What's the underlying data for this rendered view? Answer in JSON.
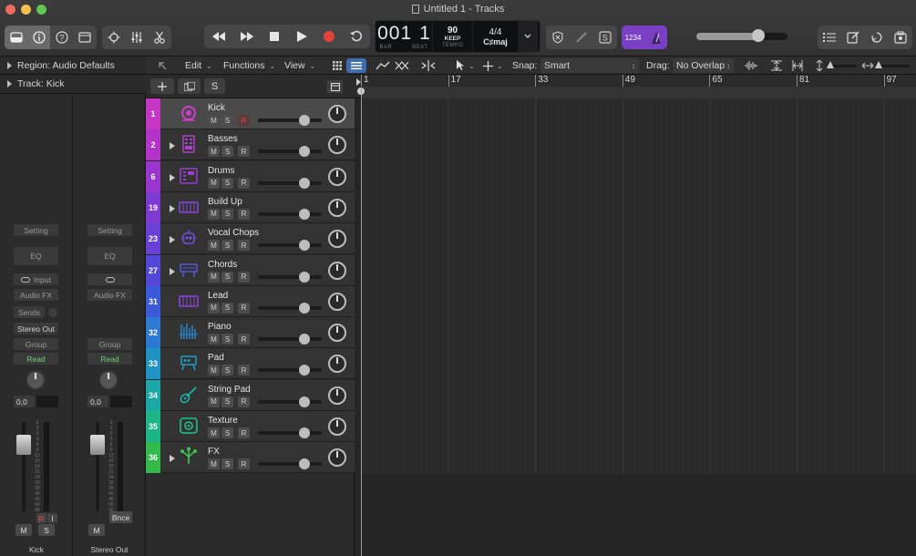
{
  "window": {
    "title": "Untitled 1 - Tracks"
  },
  "lcd": {
    "bar": "001",
    "beat": "1",
    "bar_label": "BAR",
    "beat_label": "BEAT",
    "tempo": "90",
    "tempo_mode": "KEEP",
    "tempo_label": "TEMPO",
    "time_sig": "4/4",
    "key": "C♯maj"
  },
  "count_in": "1234",
  "menu": {
    "region_label": "Region: Audio Defaults",
    "track_label": "Track:  Kick"
  },
  "toolbar2": {
    "edit": "Edit",
    "functions": "Functions",
    "view": "View",
    "snap_label": "Snap:",
    "snap_value": "Smart",
    "drag_label": "Drag:",
    "drag_value": "No Overlap"
  },
  "header": {
    "solo_label": "S"
  },
  "ruler": {
    "marks": [
      "1",
      "17",
      "33",
      "49",
      "65",
      "81",
      "97"
    ]
  },
  "inspector": {
    "strip1": {
      "setting": "Setting",
      "eq": "EQ",
      "input": "Input",
      "audio_fx": "Audio FX",
      "sends": "Sends",
      "output": "Stereo Out",
      "group": "Group",
      "automation": "Read",
      "pan_value": "0,0",
      "mute": "M",
      "solo": "S",
      "rec": "R",
      "input_mon": "I",
      "name": "Kick"
    },
    "strip2": {
      "setting": "Setting",
      "eq": "EQ",
      "audio_fx": "Audio FX",
      "group": "Group",
      "automation": "Read",
      "pan_value": "0,0",
      "mute": "M",
      "bounce": "Bnce",
      "name": "Stereo Out"
    },
    "scale": [
      "6",
      "3",
      "0",
      "3",
      "6",
      "9",
      "12",
      "15",
      "18",
      "21",
      "24",
      "30",
      "35",
      "40",
      "45",
      "50",
      "60"
    ]
  },
  "tracks": [
    {
      "num": "1",
      "name": "Kick",
      "color": "#c735c4",
      "icon": "drum-icon",
      "selected": true,
      "disclosure": false
    },
    {
      "num": "2",
      "name": "Basses",
      "color": "#b333c9",
      "icon": "sampler-icon",
      "selected": false,
      "disclosure": true
    },
    {
      "num": "6",
      "name": "Drums",
      "color": "#9a36cf",
      "icon": "drum-machine-icon",
      "selected": false,
      "disclosure": true
    },
    {
      "num": "19",
      "name": "Build Up",
      "color": "#7f39d3",
      "icon": "keyboard-icon",
      "selected": false,
      "disclosure": true
    },
    {
      "num": "23",
      "name": "Vocal Chops",
      "color": "#6a3fd8",
      "icon": "robot-icon",
      "selected": false,
      "disclosure": true
    },
    {
      "num": "27",
      "name": "Chords",
      "color": "#5347da",
      "icon": "synth-icon",
      "selected": false,
      "disclosure": true
    },
    {
      "num": "31",
      "name": "Lead",
      "color": "#3b5ad9",
      "icon": "keyboard-icon",
      "selected": false,
      "disclosure": false
    },
    {
      "num": "32",
      "name": "Piano",
      "color": "#2c79d3",
      "icon": "piano-icon",
      "selected": false,
      "disclosure": false
    },
    {
      "num": "33",
      "name": "Pad",
      "color": "#1f93c3",
      "icon": "pad-synth-icon",
      "selected": false,
      "disclosure": false
    },
    {
      "num": "34",
      "name": "String Pad",
      "color": "#19a8a6",
      "icon": "guitar-icon",
      "selected": false,
      "disclosure": false
    },
    {
      "num": "35",
      "name": "Texture",
      "color": "#1bb585",
      "icon": "texture-icon",
      "selected": false,
      "disclosure": false
    },
    {
      "num": "36",
      "name": "FX",
      "color": "#33b84a",
      "icon": "fx-icon",
      "selected": false,
      "disclosure": true
    }
  ],
  "track_buttons": {
    "mute": "M",
    "solo": "S",
    "rec": "R"
  },
  "colors": {
    "accent_purple": "#7b3fc4",
    "record_red": "#e0443a",
    "lcd_bg": "#0f1013"
  }
}
